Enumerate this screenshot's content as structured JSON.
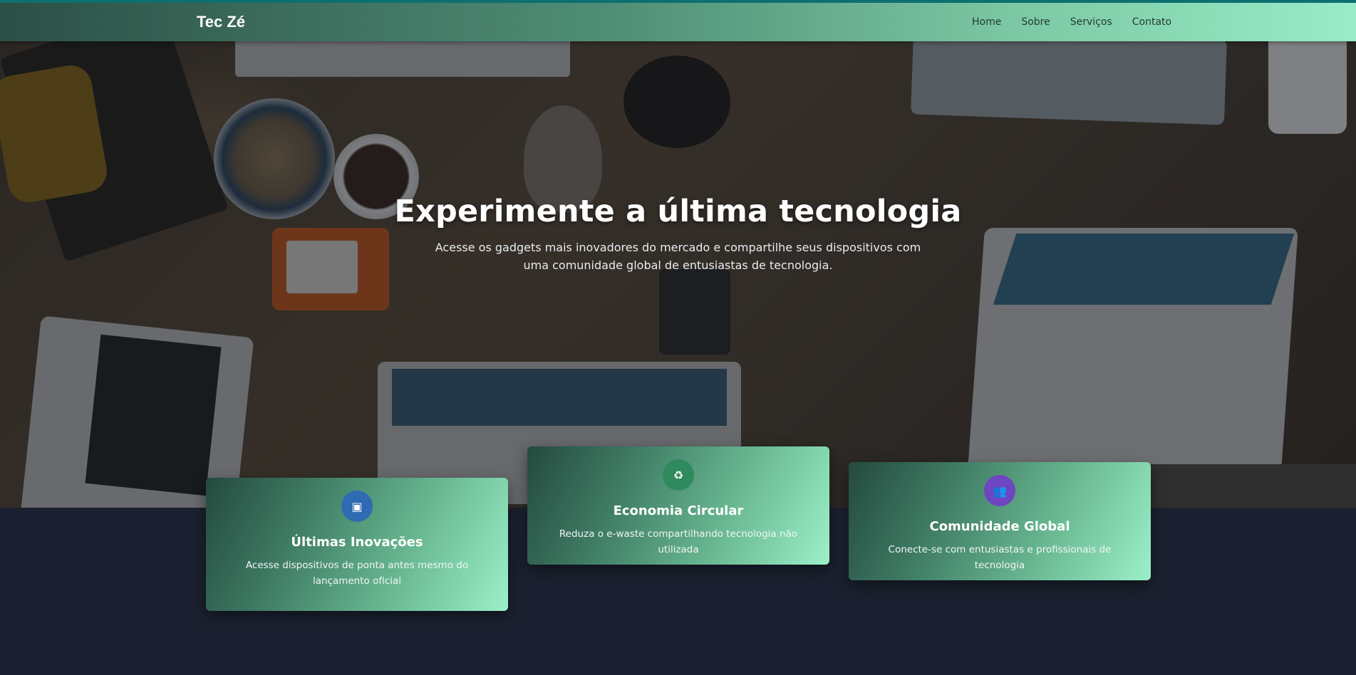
{
  "nav": {
    "brand": "Tec Zé",
    "links": [
      "Home",
      "Sobre",
      "Serviços",
      "Contato"
    ]
  },
  "hero": {
    "title": "Experimente a última tecnologia",
    "subtitle": "Acesse os gadgets mais inovadores do mercado e compartilhe seus dispositivos com uma comunidade global de entusiastas de tecnologia."
  },
  "features": [
    {
      "icon": "chip-icon",
      "icon_glyph": "▣",
      "icon_color": "#2f6bb3",
      "title": "Últimas Inovações",
      "description": "Acesse dispositivos de ponta antes mesmo do lançamento oficial"
    },
    {
      "icon": "recycle-icon",
      "icon_glyph": "♻",
      "icon_color": "#2f8a5e",
      "title": "Economia Circular",
      "description": "Reduza o e-waste compartilhando tecnologia não utilizada"
    },
    {
      "icon": "users-icon",
      "icon_glyph": "👥",
      "icon_color": "#6e46c2",
      "title": "Comunidade Global",
      "description": "Conecte-se com entusiastas e profissionais de tecnologia"
    }
  ],
  "colors": {
    "nav_gradient_start": "#2c4f46",
    "nav_gradient_end": "#98ecc7",
    "page_background": "#1b2130",
    "card_gradient_start": "#244a3e",
    "card_gradient_end": "#9cf0c8"
  }
}
